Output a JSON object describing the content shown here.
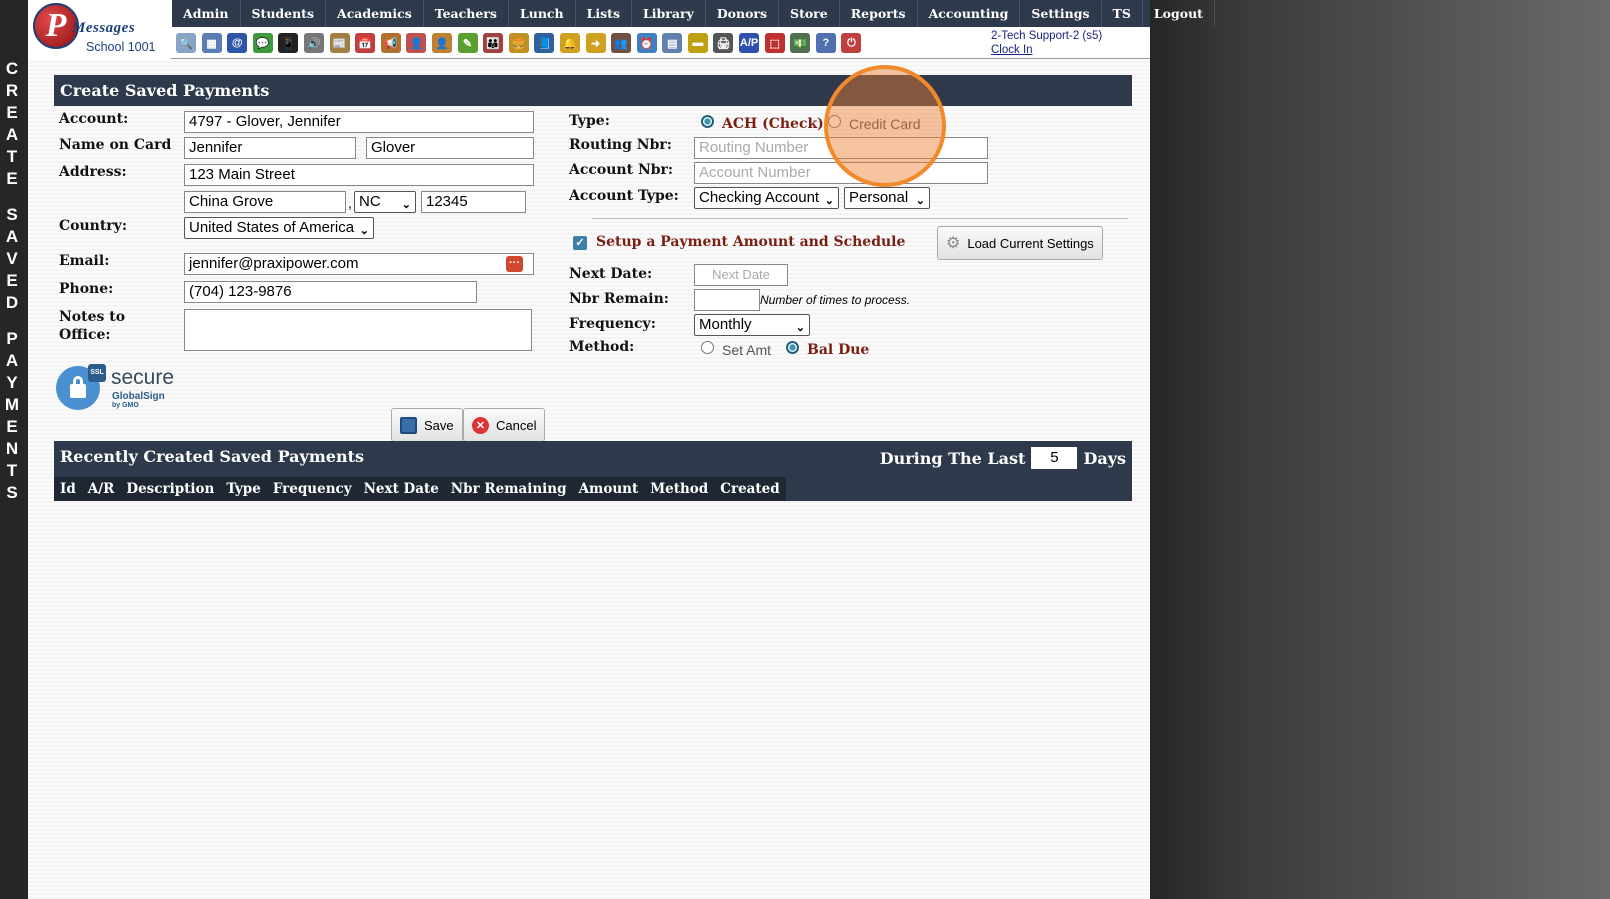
{
  "side_title": [
    "C",
    "R",
    "E",
    "A",
    "T",
    "E",
    "",
    "S",
    "A",
    "V",
    "E",
    "D",
    "",
    "P",
    "A",
    "Y",
    "M",
    "E",
    "N",
    "T",
    "S"
  ],
  "logo": {
    "initial": "P",
    "brand": "Messages",
    "school": "School 1001"
  },
  "nav": [
    "Admin",
    "Students",
    "Academics",
    "Teachers",
    "Lunch",
    "Lists",
    "Library",
    "Donors",
    "Store",
    "Reports",
    "Accounting",
    "Settings",
    "TS",
    "Logout"
  ],
  "toolbar_icons": [
    {
      "name": "search-icon",
      "color": "#8aa4c8",
      "glyph": "🔍"
    },
    {
      "name": "calendar-grid-icon",
      "color": "#5b7db5",
      "glyph": "▦"
    },
    {
      "name": "email-icon",
      "color": "#2d55a8",
      "glyph": "@"
    },
    {
      "name": "chat-icon",
      "color": "#3f9a3f",
      "glyph": "💬"
    },
    {
      "name": "phone-icon",
      "color": "#222",
      "glyph": "📱"
    },
    {
      "name": "speaker-icon",
      "color": "#777",
      "glyph": "🔊"
    },
    {
      "name": "newsletter-icon",
      "color": "#a08040",
      "glyph": "📰"
    },
    {
      "name": "calendar-icon",
      "color": "#c04040",
      "glyph": "📅"
    },
    {
      "name": "megaphone-icon",
      "color": "#b07030",
      "glyph": "📢"
    },
    {
      "name": "student-icon",
      "color": "#c05050",
      "glyph": "👤"
    },
    {
      "name": "teacher-icon",
      "color": "#c08030",
      "glyph": "👤"
    },
    {
      "name": "pencil-icon",
      "color": "#5aa030",
      "glyph": "✎"
    },
    {
      "name": "family-icon",
      "color": "#a04040",
      "glyph": "👪"
    },
    {
      "name": "lunch-icon",
      "color": "#c09020",
      "glyph": "🍔"
    },
    {
      "name": "book-icon",
      "color": "#3060a0",
      "glyph": "📘"
    },
    {
      "name": "bell-icon",
      "color": "#d0a020",
      "glyph": "🔔"
    },
    {
      "name": "arrow-icon",
      "color": "#d0a020",
      "glyph": "➜"
    },
    {
      "name": "people-icon",
      "color": "#705040",
      "glyph": "👥"
    },
    {
      "name": "clock-icon",
      "color": "#4080c0",
      "glyph": "⏰"
    },
    {
      "name": "document-icon",
      "color": "#6080b0",
      "glyph": "▤"
    },
    {
      "name": "card-icon",
      "color": "#c0a010",
      "glyph": "▬"
    },
    {
      "name": "printer-icon",
      "color": "#555",
      "glyph": "🖨"
    },
    {
      "name": "ap-icon",
      "color": "#3050b0",
      "glyph": "A/P"
    },
    {
      "name": "pdf-icon",
      "color": "#c03030",
      "glyph": "⬚"
    },
    {
      "name": "money-icon",
      "color": "#507050",
      "glyph": "💵"
    },
    {
      "name": "help-icon",
      "color": "#5070b0",
      "glyph": "?"
    },
    {
      "name": "power-icon",
      "color": "#c04040",
      "glyph": "⏻"
    }
  ],
  "user": {
    "name": "2-Tech Support-2 (s5)",
    "clock": "Clock In"
  },
  "form": {
    "header": "Create Saved Payments",
    "labels": {
      "account": "Account:",
      "name_on_card": "Name on Card",
      "address": "Address:",
      "country": "Country:",
      "email": "Email:",
      "phone": "Phone:",
      "notes": "Notes to",
      "notes2": "Office:",
      "type": "Type:",
      "routing": "Routing Nbr:",
      "account_nbr": "Account Nbr:",
      "account_type": "Account Type:",
      "next_date": "Next Date:",
      "nbr_remain": "Nbr Remain:",
      "frequency": "Frequency:",
      "method": "Method:"
    },
    "account": "4797 - Glover, Jennifer",
    "first_name": "Jennifer",
    "last_name": "Glover",
    "street": "123 Main Street",
    "city": "China Grove",
    "state": "NC",
    "zip": "12345",
    "country": "United States of America",
    "email": "jennifer@praxipower.com",
    "phone": "(704) 123-9876",
    "notes": "",
    "type_ach": "ACH (Check)",
    "type_cc": "Credit Card",
    "routing_placeholder": "Routing Number",
    "account_placeholder": "Account Number",
    "account_type": "Checking Account",
    "account_kind": "Personal",
    "schedule_label": "Setup a Payment Amount and Schedule",
    "load_button": "Load Current Settings",
    "next_date_placeholder": "Next Date",
    "nbr_remain_hint": "Number of times to process.",
    "frequency": "Monthly",
    "method_set": "Set Amt",
    "method_bal": "Bal Due",
    "save": "Save",
    "cancel": "Cancel",
    "ssl": {
      "badge": "SSL",
      "secure": "secure",
      "brand": "GlobalSign",
      "by": "by GMO"
    }
  },
  "recent": {
    "header": "Recently Created Saved Payments",
    "during": "During The Last",
    "days_value": "5",
    "days": "Days",
    "columns": [
      "Id",
      "A/R",
      "Description",
      "Type",
      "Frequency",
      "Next Date",
      "Nbr Remaining",
      "Amount",
      "Method",
      "Created"
    ]
  }
}
